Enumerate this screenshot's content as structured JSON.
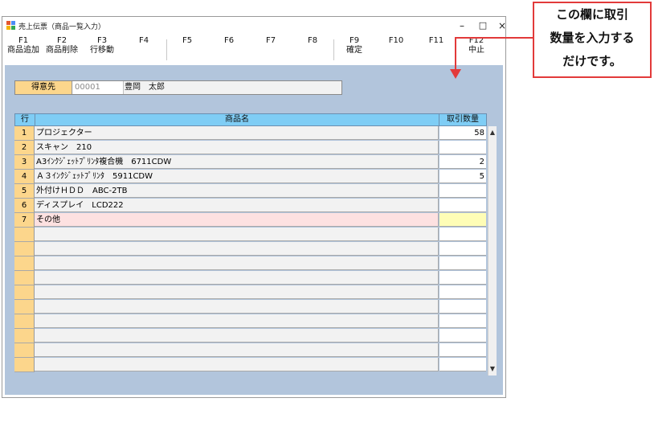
{
  "window": {
    "title": "売上伝票（商品一覧入力）",
    "controls": {
      "minimize": "–",
      "maximize": "□",
      "close": "×"
    }
  },
  "function_keys": [
    {
      "key": "F1",
      "label": "商品追加"
    },
    {
      "key": "F2",
      "label": "商品削除"
    },
    {
      "key": "F3",
      "label": "行移動"
    },
    {
      "key": "F4",
      "label": ""
    },
    {
      "key": "F5",
      "label": ""
    },
    {
      "key": "F6",
      "label": ""
    },
    {
      "key": "F7",
      "label": ""
    },
    {
      "key": "F8",
      "label": ""
    },
    {
      "key": "F9",
      "label": "確定"
    },
    {
      "key": "F10",
      "label": ""
    },
    {
      "key": "F11",
      "label": ""
    },
    {
      "key": "F12",
      "label": "中止"
    }
  ],
  "customer": {
    "label": "得意先",
    "code": "00001",
    "name": "豊岡　太郎"
  },
  "grid": {
    "headers": {
      "row": "行",
      "name": "商品名",
      "qty": "取引数量"
    },
    "rows": [
      {
        "num": "1",
        "name": "プロジェクター",
        "qty": "58"
      },
      {
        "num": "2",
        "name": "スキャン　210",
        "qty": ""
      },
      {
        "num": "3",
        "name": "A3ｲﾝｸｼﾞｪｯﾄﾌﾟﾘﾝﾀ複合機　6711CDW",
        "qty": "2"
      },
      {
        "num": "4",
        "name": "Ａ３ｲﾝｸｼﾞｪｯﾄﾌﾟﾘﾝﾀ　5911CDW",
        "qty": "5"
      },
      {
        "num": "5",
        "name": "外付けＨＤＤ　ABC-2TB",
        "qty": ""
      },
      {
        "num": "6",
        "name": "ディスプレイ　LCD222",
        "qty": ""
      },
      {
        "num": "7",
        "name": "その他",
        "qty": ""
      },
      {
        "num": "",
        "name": "",
        "qty": ""
      },
      {
        "num": "",
        "name": "",
        "qty": ""
      },
      {
        "num": "",
        "name": "",
        "qty": ""
      },
      {
        "num": "",
        "name": "",
        "qty": ""
      },
      {
        "num": "",
        "name": "",
        "qty": ""
      },
      {
        "num": "",
        "name": "",
        "qty": ""
      },
      {
        "num": "",
        "name": "",
        "qty": ""
      },
      {
        "num": "",
        "name": "",
        "qty": ""
      },
      {
        "num": "",
        "name": "",
        "qty": ""
      },
      {
        "num": "",
        "name": "",
        "qty": ""
      }
    ],
    "scroll": {
      "up": "▲",
      "down": "▼"
    }
  },
  "callout": {
    "lines": [
      "この欄に取引",
      "数量を入力する",
      "だけです。"
    ],
    "color": "#e23a3a"
  }
}
